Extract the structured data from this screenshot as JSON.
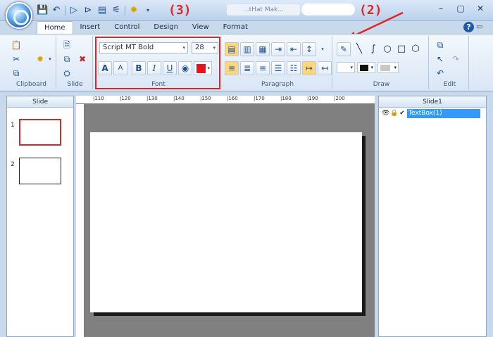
{
  "titlebar": {
    "title_text": "...tHat Mak...",
    "controls": [
      "–",
      "▢",
      "✕"
    ]
  },
  "tabs": [
    "Home",
    "Insert",
    "Control",
    "Design",
    "View",
    "Format"
  ],
  "ribbon": {
    "groups": {
      "clipboard": "Clipboard",
      "slide": "Slide",
      "font": "Font",
      "paragraph": "Paragraph",
      "draw": "Draw",
      "edit": "Edit"
    },
    "font": {
      "family": "Script MT Bold",
      "size": "28",
      "grow_label": "A",
      "shrink_label": "A",
      "bold_label": "B",
      "italic_label": "I",
      "underline_label": "U",
      "font_color": "#e3141b"
    }
  },
  "annotations": {
    "label_3": "(3)",
    "label_2": "(2)"
  },
  "left_panel": {
    "header": "Slide",
    "slides": [
      {
        "number": "1"
      },
      {
        "number": "2"
      }
    ]
  },
  "ruler": {
    "marks": [
      "|110",
      "|120",
      "|130",
      "|140",
      "|150",
      "|160",
      "|170",
      "|180",
      "|190",
      "|200"
    ]
  },
  "right_panel": {
    "header": "Slide1",
    "item": "TextBox(1)"
  },
  "colors": {
    "accent": "#3399ff",
    "highlight": "#e02525"
  }
}
